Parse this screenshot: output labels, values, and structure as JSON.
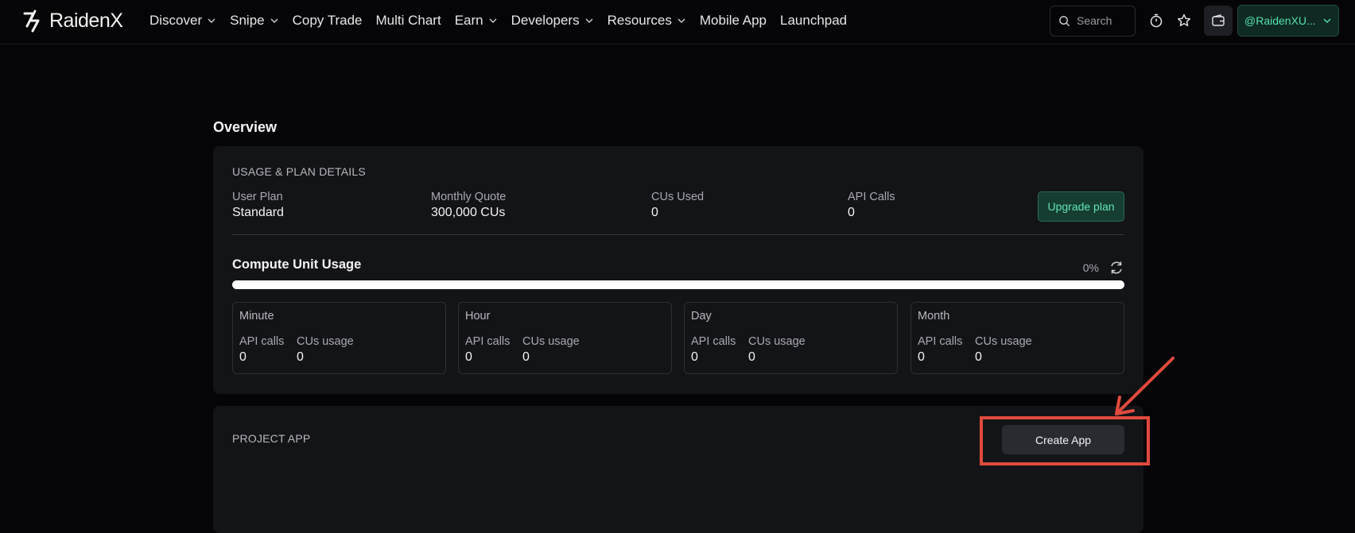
{
  "brand": {
    "name": "RaidenX"
  },
  "nav": [
    {
      "label": "Discover",
      "dropdown": true
    },
    {
      "label": "Snipe",
      "dropdown": true
    },
    {
      "label": "Copy Trade",
      "dropdown": false
    },
    {
      "label": "Multi Chart",
      "dropdown": false
    },
    {
      "label": "Earn",
      "dropdown": true
    },
    {
      "label": "Developers",
      "dropdown": true
    },
    {
      "label": "Resources",
      "dropdown": true
    },
    {
      "label": "Mobile App",
      "dropdown": false
    },
    {
      "label": "Launchpad",
      "dropdown": false
    }
  ],
  "search": {
    "placeholder": "Search"
  },
  "account": {
    "label": "@RaidenXU..."
  },
  "overview": {
    "title": "Overview",
    "usage_section_label": "USAGE & PLAN DETAILS",
    "stats": [
      {
        "label": "User Plan",
        "value": "Standard"
      },
      {
        "label": "Monthly Quote",
        "value": "300,000 CUs"
      },
      {
        "label": "CUs Used",
        "value": "0"
      },
      {
        "label": "API Calls",
        "value": "0"
      }
    ],
    "upgrade_label": "Upgrade plan",
    "compute_title": "Compute Unit Usage",
    "compute_percent_text": "0%",
    "compute_progress": 0,
    "periods": [
      {
        "title": "Minute",
        "api_label": "API calls",
        "api_value": "0",
        "cu_label": "CUs usage",
        "cu_value": "0"
      },
      {
        "title": "Hour",
        "api_label": "API calls",
        "api_value": "0",
        "cu_label": "CUs usage",
        "cu_value": "0"
      },
      {
        "title": "Day",
        "api_label": "API calls",
        "api_value": "0",
        "cu_label": "CUs usage",
        "cu_value": "0"
      },
      {
        "title": "Month",
        "api_label": "API calls",
        "api_value": "0",
        "cu_label": "CUs usage",
        "cu_value": "0"
      }
    ]
  },
  "project": {
    "section_label": "PROJECT APP",
    "create_label": "Create App"
  },
  "colors": {
    "accent": "#55e0b0",
    "annotation": "#e04a3c"
  },
  "icons": {
    "logo": "raidenx-bolt-icon",
    "search": "search-icon",
    "timer": "stopwatch-icon",
    "favorite": "star-icon",
    "wallet": "wallet-icon",
    "refresh": "refresh-icon"
  }
}
